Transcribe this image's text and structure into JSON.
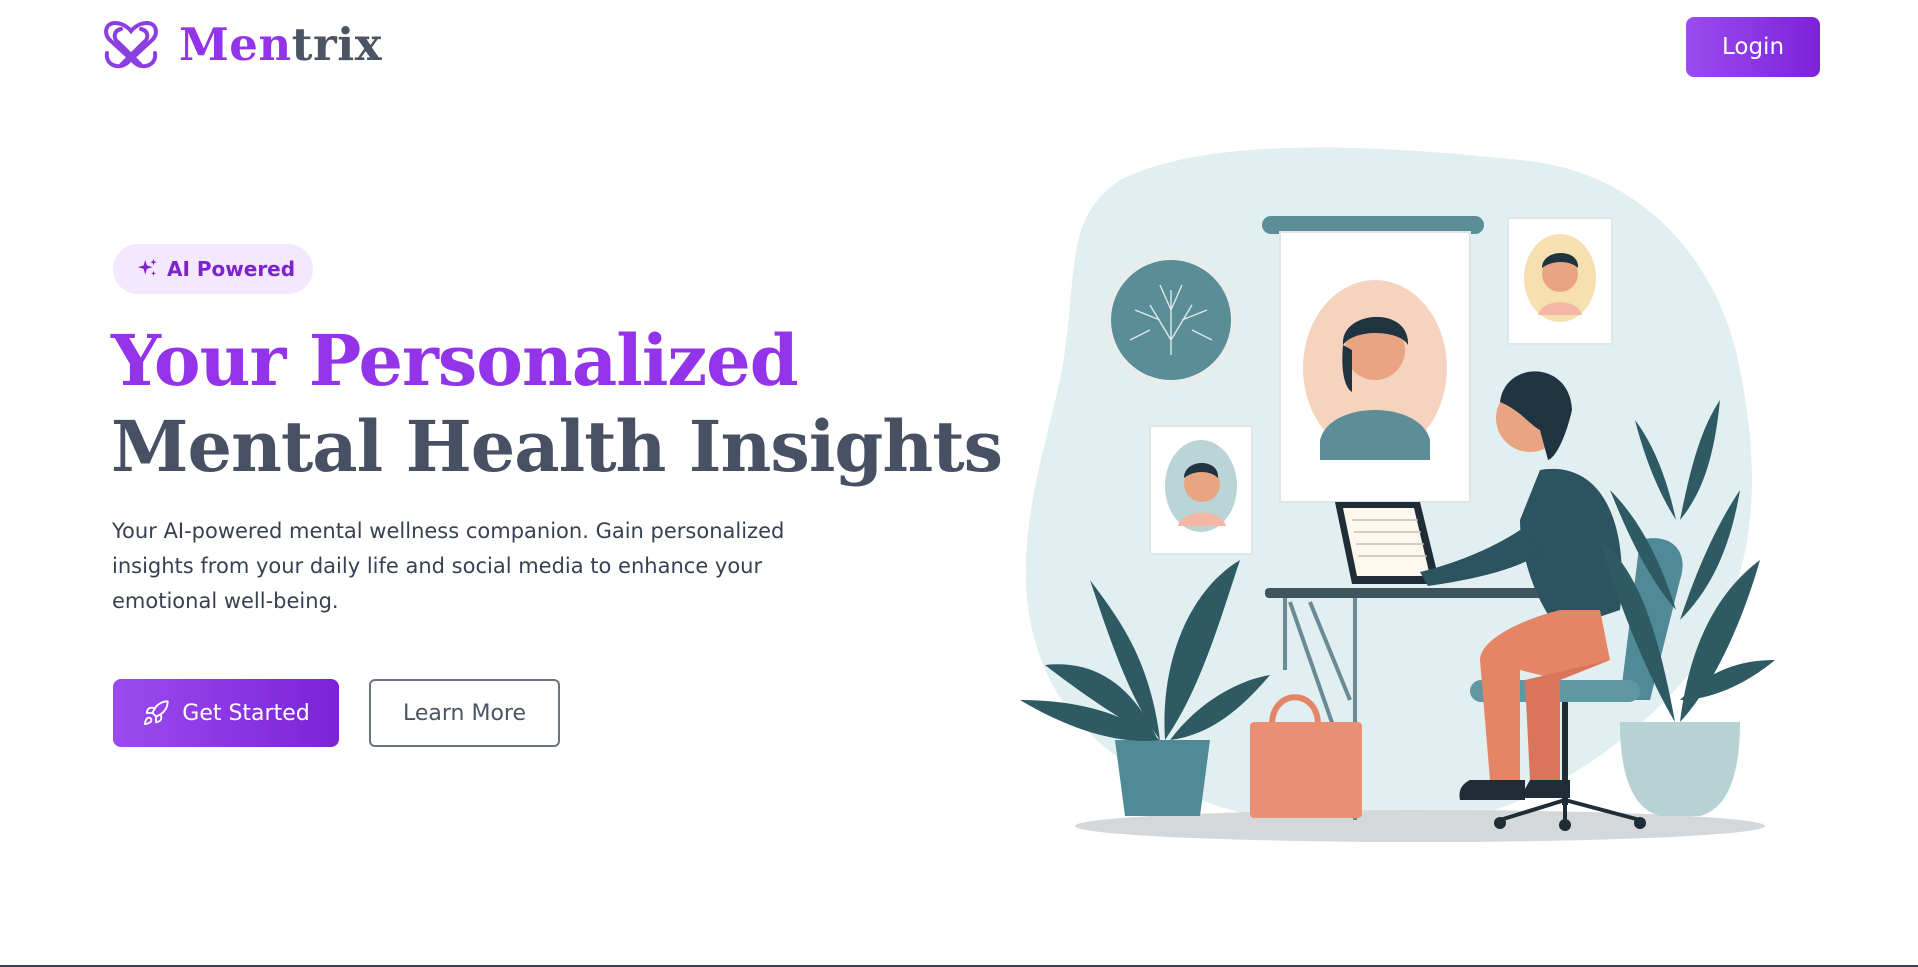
{
  "brand": {
    "name_part1": "Men",
    "name_part2": "trix",
    "logo_icon": "mentrix-knot-logo-icon"
  },
  "header": {
    "login_label": "Login"
  },
  "hero": {
    "badge_label": "AI Powered",
    "badge_icon": "sparkles-icon",
    "title_line1": "Your Personalized",
    "title_line2": "Mental Health Insights",
    "description": "Your AI-powered mental wellness companion. Gain personalized insights from your daily life and social media to enhance your emotional well-being.",
    "primary_cta_label": "Get Started",
    "primary_cta_icon": "rocket-icon",
    "secondary_cta_label": "Learn More"
  },
  "colors": {
    "accent": "#9333ea",
    "accent_dark": "#7c22d8",
    "heading_gray": "#475163",
    "badge_bg": "#f3e8ff",
    "text": "#374151"
  }
}
